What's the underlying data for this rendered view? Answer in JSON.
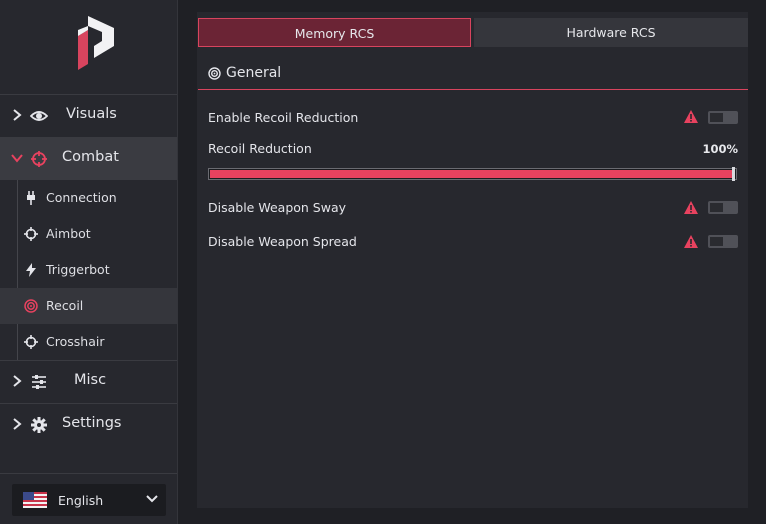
{
  "sidebar": {
    "logo": "app-logo-icon",
    "nav": {
      "visuals": {
        "label": "Visuals",
        "icon": "eye-icon"
      },
      "combat": {
        "label": "Combat",
        "icon": "crosshair-icon"
      },
      "misc": {
        "label": "Misc",
        "icon": "sliders-icon"
      },
      "settings": {
        "label": "Settings",
        "icon": "gear-icon"
      }
    },
    "combat_items": [
      {
        "label": "Connection",
        "icon": "plug-icon"
      },
      {
        "label": "Aimbot",
        "icon": "crosshair-icon"
      },
      {
        "label": "Triggerbot",
        "icon": "lightning-icon"
      },
      {
        "label": "Recoil",
        "icon": "target-icon"
      },
      {
        "label": "Crosshair",
        "icon": "crosshair-icon"
      }
    ],
    "language": {
      "label": "English",
      "icon": "us-flag-icon"
    }
  },
  "tabs": {
    "memory": "Memory RCS",
    "hardware": "Hardware RCS"
  },
  "section": {
    "title": "General",
    "icon": "target-icon"
  },
  "settings": {
    "enable_recoil_reduction": {
      "label": "Enable Recoil Reduction",
      "enabled": false
    },
    "recoil_reduction": {
      "label": "Recoil Reduction",
      "value_text": "100%",
      "value": 100
    },
    "disable_weapon_sway": {
      "label": "Disable Weapon Sway",
      "enabled": false
    },
    "disable_weapon_spread": {
      "label": "Disable Weapon Spread",
      "enabled": false
    }
  },
  "colors": {
    "accent": "#e8425f",
    "warning": "#e8425f",
    "sidebar_bg": "#27282e",
    "page_bg": "#1f2025"
  }
}
